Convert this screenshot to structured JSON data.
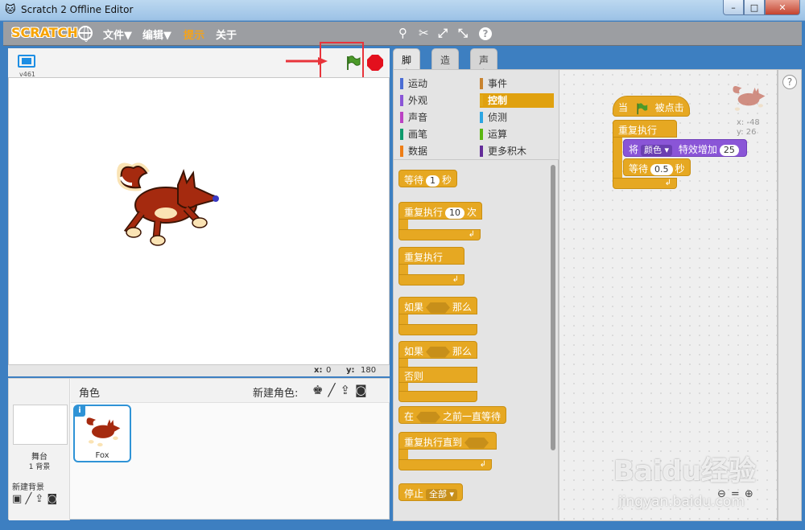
{
  "window": {
    "title": "Scratch 2 Offline Editor",
    "min": "–",
    "max": "□",
    "close": "✕"
  },
  "menubar": {
    "logo": "SCRATCH",
    "items": [
      "文件▼",
      "编辑▼",
      "提示",
      "关于"
    ],
    "tool_icons": [
      "duplicate-icon",
      "delete-icon",
      "grow-icon",
      "shrink-icon",
      "help-icon"
    ]
  },
  "stage": {
    "version": "v461",
    "coord_x_label": "x:",
    "coord_x": "0",
    "coord_y_label": "y:",
    "coord_y": "180"
  },
  "sprites_panel": {
    "title": "角色",
    "new_sprite_label": "新建角色:",
    "stage_label": "舞台",
    "stage_bg_count": "1 背景",
    "new_bg_label": "新建背景",
    "sprite_name": "Fox"
  },
  "tabs": [
    "脚本",
    "造型",
    "声音"
  ],
  "categories": [
    {
      "label": "运动",
      "color": "#4a6cd4"
    },
    {
      "label": "事件",
      "color": "#c88330"
    },
    {
      "label": "外观",
      "color": "#8a55d7"
    },
    {
      "label": "控制",
      "color": "#e1a91a"
    },
    {
      "label": "声音",
      "color": "#bb42c3"
    },
    {
      "label": "侦测",
      "color": "#2ca5e2"
    },
    {
      "label": "画笔",
      "color": "#0e9a6c"
    },
    {
      "label": "运算",
      "color": "#5cb712"
    },
    {
      "label": "数据",
      "color": "#ee7d16"
    },
    {
      "label": "更多积木",
      "color": "#632d99"
    }
  ],
  "palette_blocks": {
    "wait": "等待",
    "wait_val": "1",
    "wait_unit": "秒",
    "repeat": "重复执行",
    "repeat_val": "10",
    "repeat_unit": "次",
    "forever": "重复执行",
    "if": "如果",
    "then": "那么",
    "if2": "如果",
    "then2": "那么",
    "else": "否则",
    "wait_until_pre": "在",
    "wait_until_post": "之前一直等待",
    "repeat_until": "重复执行直到",
    "stop": "停止",
    "stop_opt": "全部"
  },
  "script": {
    "hat_when": "当",
    "hat_clicked": "被点击",
    "forever": "重复执行",
    "effect_pre": "将",
    "effect_opt": "颜色",
    "effect_mid": "特效增加",
    "effect_val": "25",
    "wait": "等待",
    "wait_val": "0.5",
    "wait_unit": "秒",
    "sprite_x": "x: -48",
    "sprite_y": "y: 26"
  },
  "watermark": {
    "main": "Baidu经验",
    "sub": "jingyan.baidu.com"
  }
}
